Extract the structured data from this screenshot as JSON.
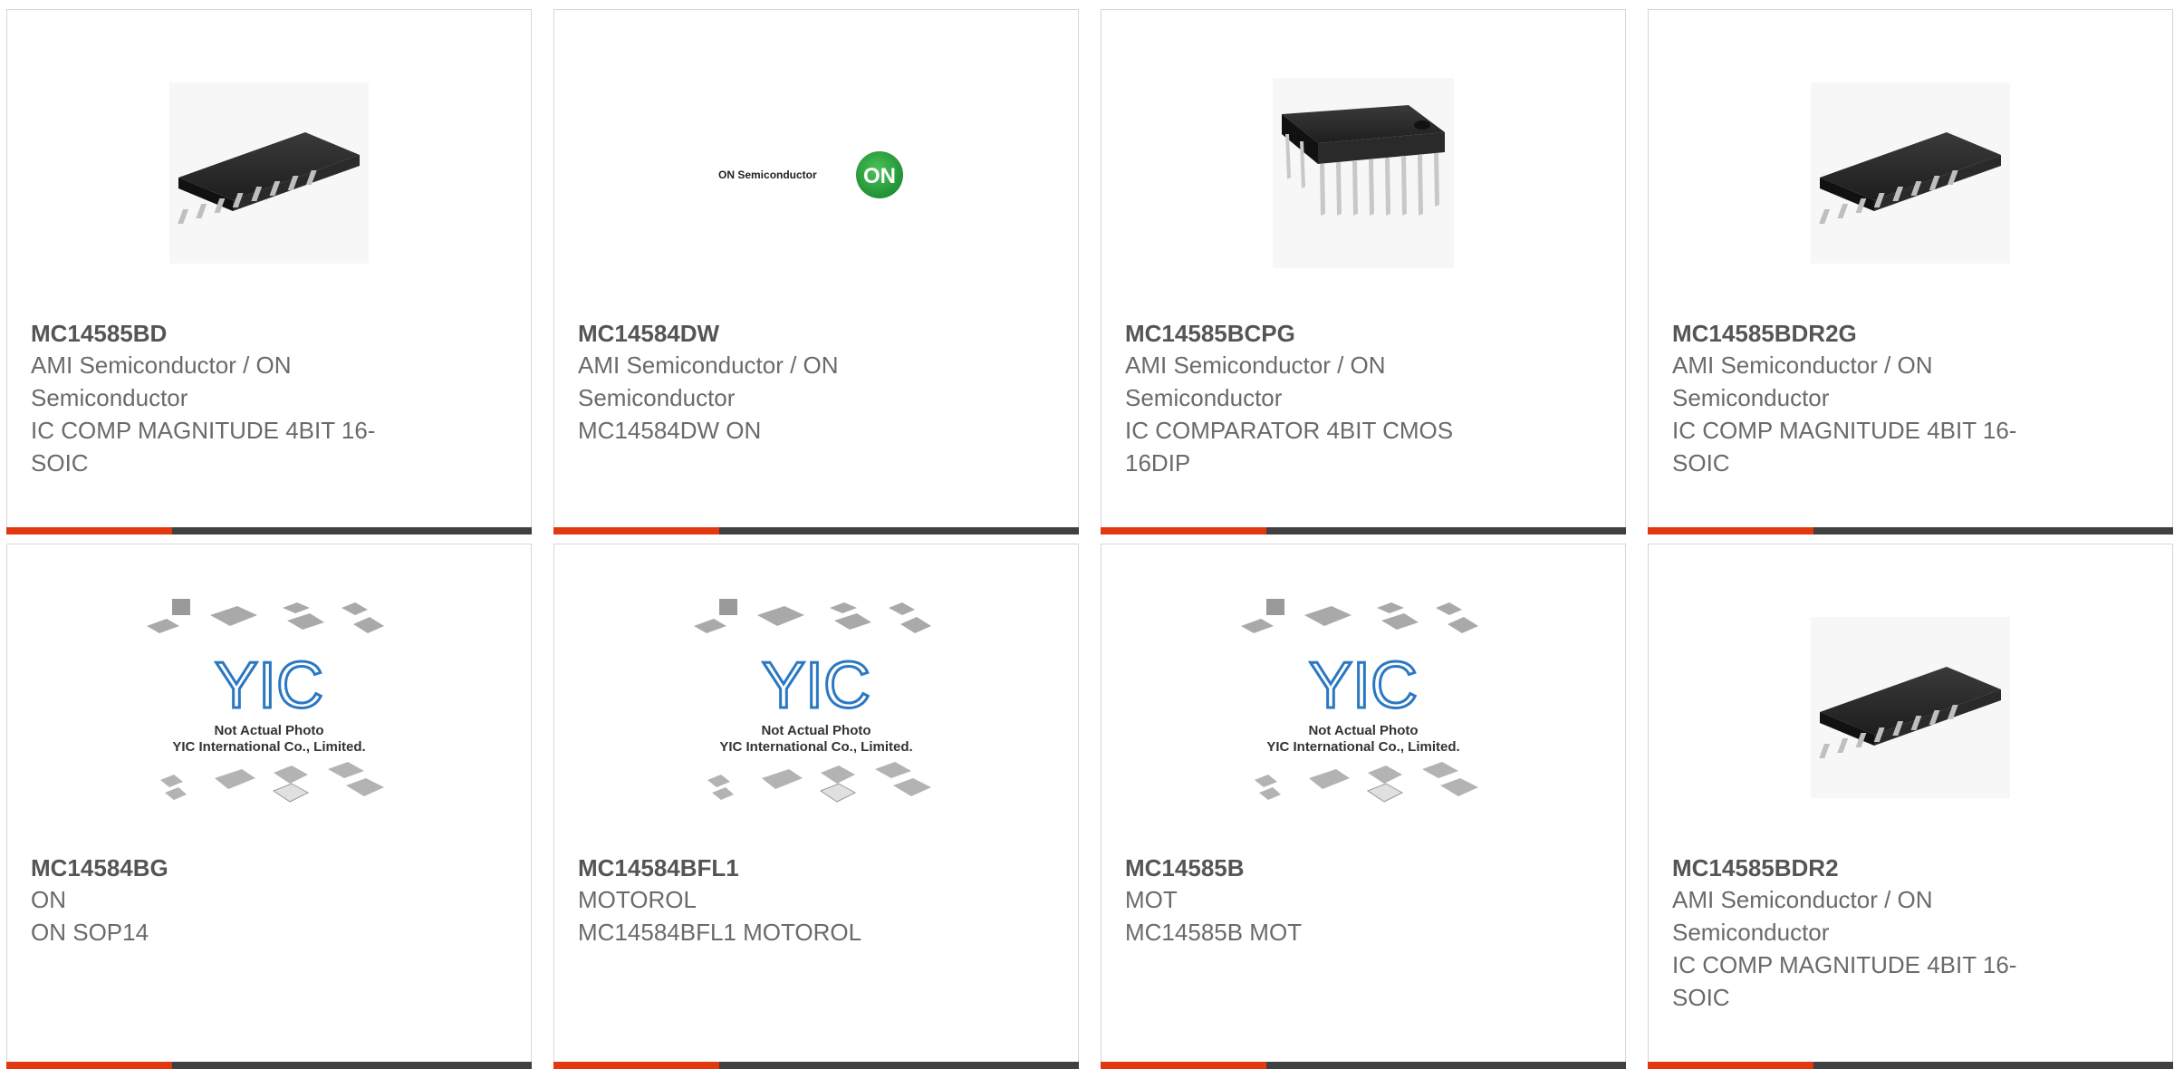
{
  "colors": {
    "accent": "#e3380f",
    "bar": "#404040",
    "border": "#d6d6d6",
    "text": "#6a6a6a"
  },
  "products": [
    {
      "part_number": "MC14585BD",
      "manufacturer": "AMI Semiconductor / ON Semiconductor",
      "description": "IC COMP MAGNITUDE 4BIT 16-SOIC",
      "image": "soic-chip"
    },
    {
      "part_number": "MC14584DW",
      "manufacturer": "AMI Semiconductor / ON Semiconductor",
      "description": "MC14584DW ON",
      "image": "on-semiconductor-logo"
    },
    {
      "part_number": "MC14585BCPG",
      "manufacturer": "AMI Semiconductor / ON Semiconductor",
      "description": "IC COMPARATOR 4BIT CMOS 16DIP",
      "image": "dip-chip"
    },
    {
      "part_number": "MC14585BDR2G",
      "manufacturer": "AMI Semiconductor / ON Semiconductor",
      "description": "IC COMP MAGNITUDE 4BIT 16-SOIC",
      "image": "soic-chip"
    },
    {
      "part_number": "MC14584BG",
      "manufacturer": "ON",
      "description": "ON SOP14",
      "image": "yic-placeholder"
    },
    {
      "part_number": "MC14584BFL1",
      "manufacturer": "MOTOROL",
      "description": "MC14584BFL1 MOTOROL",
      "image": "yic-placeholder"
    },
    {
      "part_number": "MC14585B",
      "manufacturer": "MOT",
      "description": "MC14585B MOT",
      "image": "yic-placeholder"
    },
    {
      "part_number": "MC14585BDR2",
      "manufacturer": "AMI Semiconductor / ON Semiconductor",
      "description": "IC COMP MAGNITUDE 4BIT 16-SOIC",
      "image": "soic-chip"
    }
  ],
  "logo": {
    "text": "ON Semiconductor",
    "badge": "ON"
  },
  "placeholder": {
    "line1": "Not Actual Photo",
    "line2": "YIC International Co., Limited.",
    "mark": "YIC"
  }
}
